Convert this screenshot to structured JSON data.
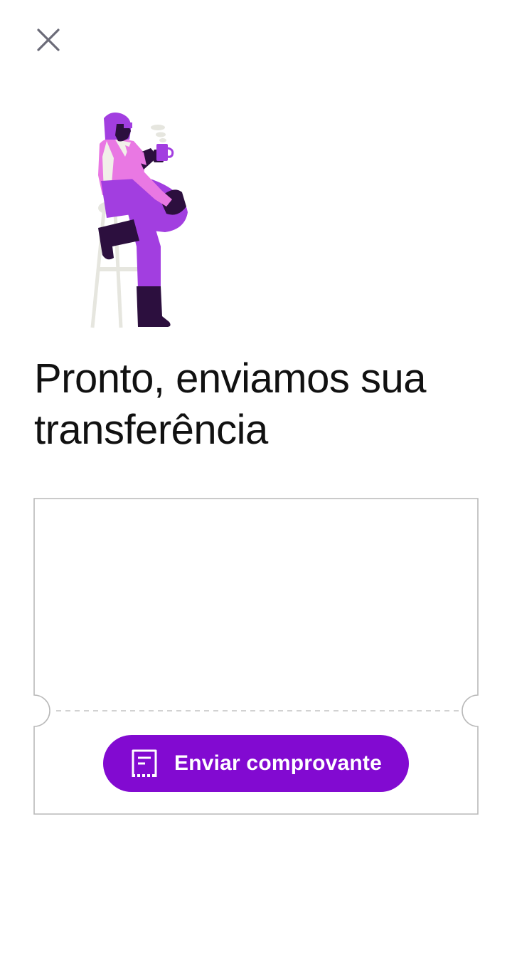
{
  "header": {
    "close_icon": "close-icon"
  },
  "illustration": {
    "name": "woman-on-stool-with-coffee-illustration",
    "colors": {
      "hair": "#a23ee0",
      "shirt": "#e978e3",
      "pants": "#a23ee0",
      "boots": "#2c0f3e",
      "stool": "#e6e6df",
      "cup": "#a23ee0"
    }
  },
  "main": {
    "title": "Pronto, enviamos sua transferência"
  },
  "receipt": {
    "send_button_label": "Enviar comprovante",
    "send_button_icon": "receipt-icon",
    "accent_color": "#820ad1"
  }
}
